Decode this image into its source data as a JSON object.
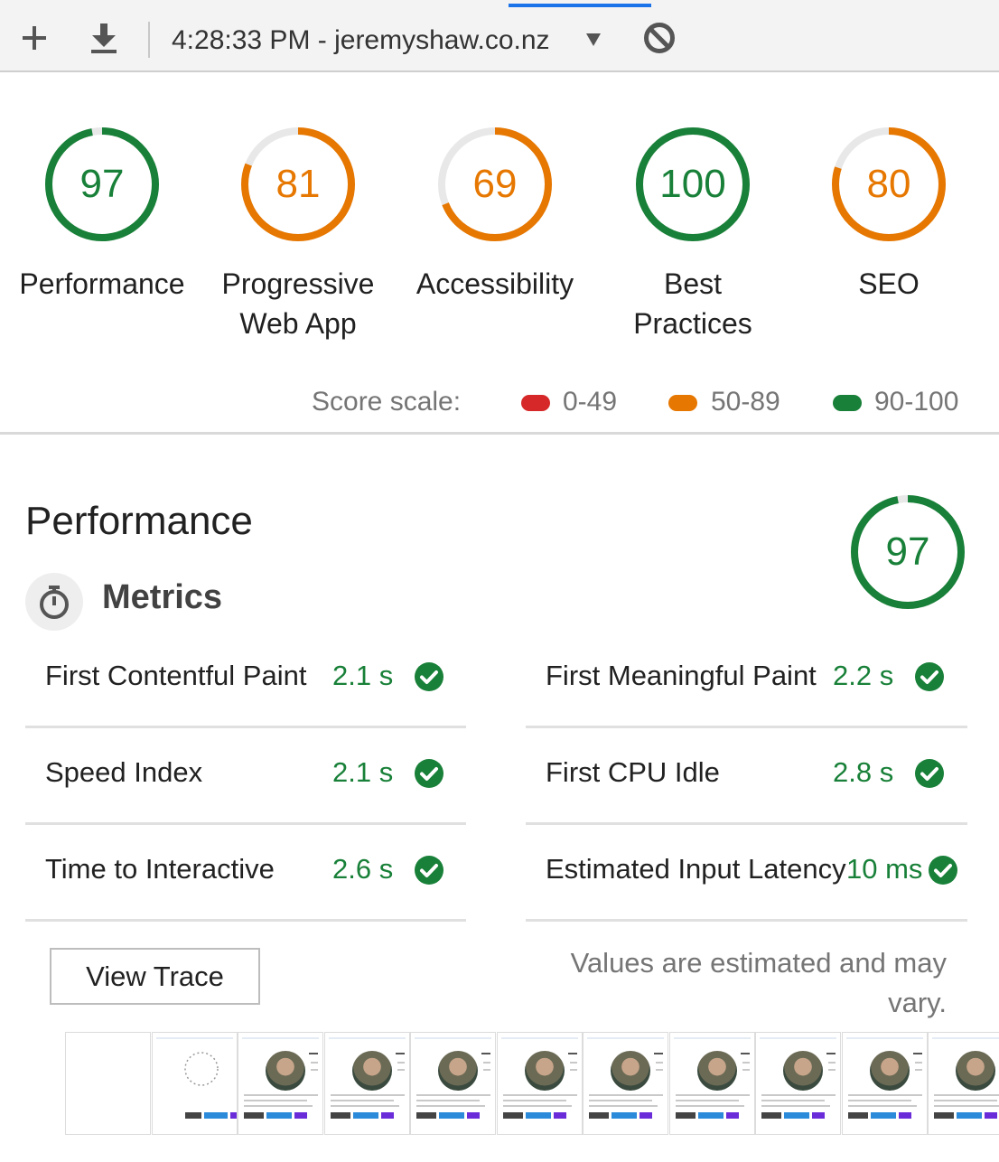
{
  "toolbar": {
    "title": "4:28:33 PM - jeremyshaw.co.nz",
    "icons": [
      "plus-icon",
      "download-icon",
      "caret-down-icon",
      "block-icon"
    ]
  },
  "colors": {
    "pass": "#188038",
    "average": "#e67700",
    "fail": "#d62828",
    "track": "#e8e8e8"
  },
  "gauges": [
    {
      "score": "97",
      "value": 97,
      "label_lines": [
        "Performance"
      ],
      "status": "pass"
    },
    {
      "score": "81",
      "value": 81,
      "label_lines": [
        "Progressive",
        "Web App"
      ],
      "status": "average"
    },
    {
      "score": "69",
      "value": 69,
      "label_lines": [
        "Accessibility"
      ],
      "status": "average"
    },
    {
      "score": "100",
      "value": 100,
      "label_lines": [
        "Best",
        "Practices"
      ],
      "status": "pass"
    },
    {
      "score": "80",
      "value": 80,
      "label_lines": [
        "SEO"
      ],
      "status": "average"
    }
  ],
  "scale": {
    "label": "Score scale:",
    "ranges": [
      {
        "text": "0-49",
        "status": "fail"
      },
      {
        "text": "50-89",
        "status": "average"
      },
      {
        "text": "90-100",
        "status": "pass"
      }
    ]
  },
  "performance": {
    "title": "Performance",
    "score": "97",
    "value": 97,
    "metrics_title": "Metrics",
    "metrics": [
      {
        "name": "First Contentful Paint",
        "value": "2.1 s"
      },
      {
        "name": "First Meaningful Paint",
        "value": "2.2 s"
      },
      {
        "name": "Speed Index",
        "value": "2.1 s"
      },
      {
        "name": "First CPU Idle",
        "value": "2.8 s"
      },
      {
        "name": "Time to Interactive",
        "value": "2.6 s"
      },
      {
        "name": "Estimated Input Latency",
        "value": "10 ms"
      }
    ],
    "view_trace_label": "View Trace",
    "note": "Values are estimated and may vary."
  },
  "filmstrip": {
    "frame_count": 10
  }
}
